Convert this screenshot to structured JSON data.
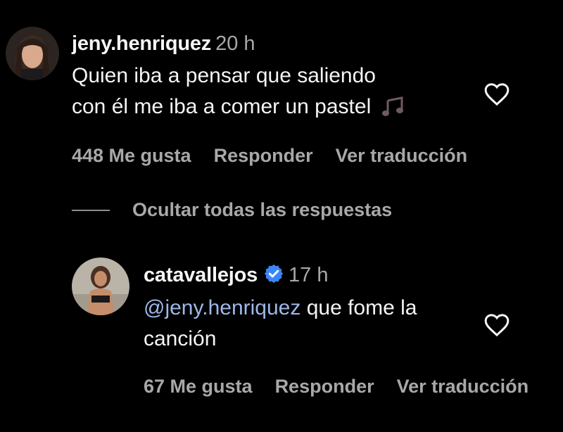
{
  "comment": {
    "username": "jeny.henriquez",
    "time": "20 h",
    "text_line1": "Quien iba a pensar que saliendo",
    "text_line2": "con él me iba a comer un pastel",
    "emoji_icon": "music-notes-icon",
    "likes": "448 Me gusta",
    "reply_label": "Responder",
    "translate_label": "Ver traducción"
  },
  "replies_toggle": {
    "label": "Ocultar todas las respuestas"
  },
  "reply": {
    "username": "catavallejos",
    "verified": true,
    "time": "17 h",
    "mention": "@jeny.henriquez",
    "text_line1_rest": " que fome la",
    "text_line2": "canción",
    "likes": "67 Me gusta",
    "reply_label": "Responder",
    "translate_label": "Ver traducción"
  },
  "colors": {
    "background": "#000000",
    "text": "#f5f5f5",
    "secondary": "#a8a8a8",
    "verified_badge": "#3b86f7",
    "mention": "#9fb8e8"
  }
}
